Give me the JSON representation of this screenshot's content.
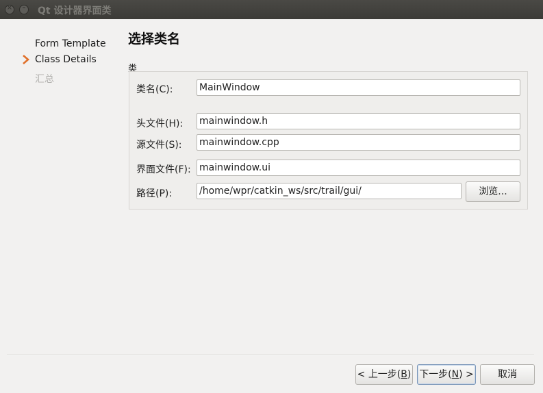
{
  "window": {
    "title": "Qt 设计器界面类",
    "close_icon": "close-icon",
    "minimize_icon": "minimize-icon"
  },
  "sidebar": {
    "items": [
      {
        "label": "Form Template",
        "state": "done"
      },
      {
        "label": "Class Details",
        "state": "active"
      },
      {
        "label": "汇总",
        "state": "pending"
      }
    ],
    "current_icon": "chevron-right-icon"
  },
  "page": {
    "title": "选择类名",
    "group_label": "类"
  },
  "fields": {
    "class_name": {
      "label": "类名(C):",
      "mnemonic": "C",
      "value": "MainWindow"
    },
    "header_file": {
      "label": "头文件(H):",
      "mnemonic": "H",
      "value": "mainwindow.h"
    },
    "source_file": {
      "label": "源文件(S):",
      "mnemonic": "S",
      "value": "mainwindow.cpp"
    },
    "form_file": {
      "label": "界面文件(F):",
      "mnemonic": "F",
      "value": "mainwindow.ui"
    },
    "path": {
      "label": "路径(P):",
      "mnemonic": "P",
      "value": "/home/wpr/catkin_ws/src/trail/gui/"
    }
  },
  "browse_button": {
    "label": "浏览..."
  },
  "footer": {
    "back": {
      "prefix": "< ",
      "text": "上一步(",
      "mnemonic": "B",
      "suffix": ")"
    },
    "next": {
      "text": "下一步(",
      "mnemonic": "N",
      "suffix": ") >"
    },
    "cancel": {
      "label": "取消"
    }
  }
}
